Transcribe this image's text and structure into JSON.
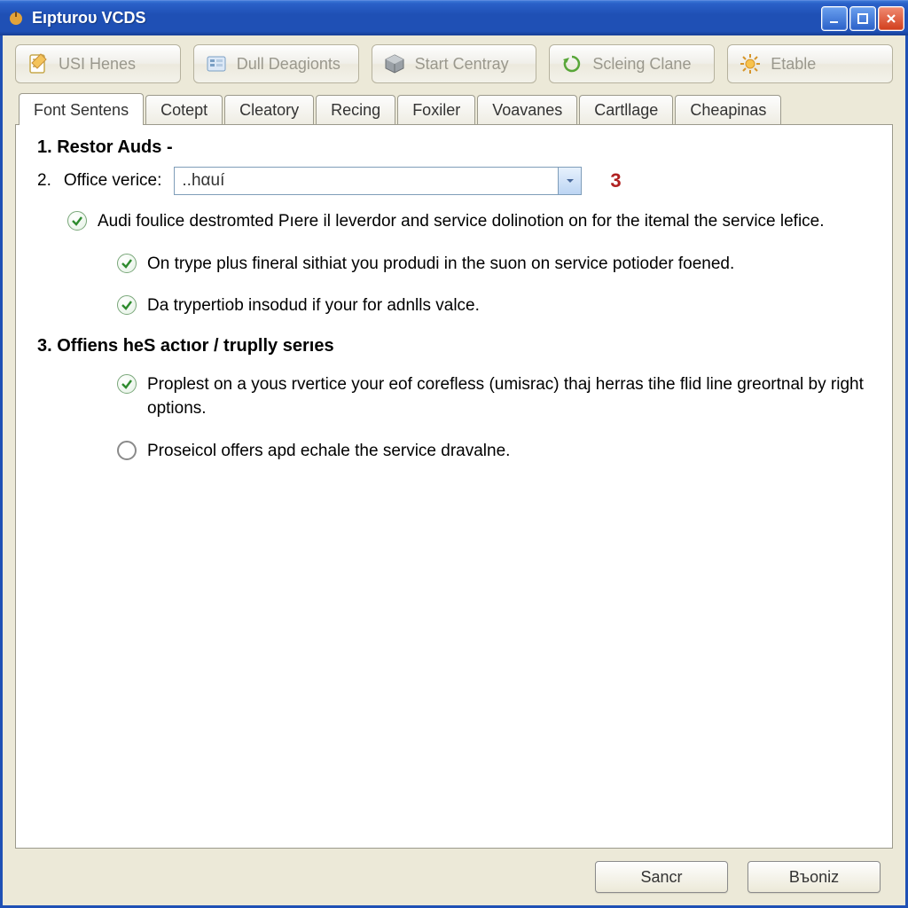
{
  "window": {
    "title": "Eıpturoυ VCDS"
  },
  "toolbar": [
    {
      "label": "USI Henes",
      "icon": "note-icon"
    },
    {
      "label": "Dull Deagionts",
      "icon": "list-icon"
    },
    {
      "label": "Start Centray",
      "icon": "cube-icon"
    },
    {
      "label": "Scleing Clane",
      "icon": "refresh-icon"
    },
    {
      "label": "Etable",
      "icon": "gear-icon"
    }
  ],
  "tabs": [
    "Font Sentens",
    "Cotept",
    "Cleatory",
    "Recing",
    "Foxiler",
    "Voavanes",
    "Cartllage",
    "Cheapinas"
  ],
  "active_tab": 0,
  "step1": {
    "heading": "1. Restor Auds  -"
  },
  "step2": {
    "num": "2.",
    "label": "Office verice:",
    "combo_value": "..hαuí",
    "marker": "3"
  },
  "items": {
    "a": "Audi foulice destromted Pıere il leverdor and service dolinotion on for the itemal the service lefice.",
    "b": "On trype plus fineral sithiat you produdi in the suon on service potioder foened.",
    "c": "Da trypertiob insodud if your for adnlls valce."
  },
  "step3": {
    "heading": "3. Offiens heS actıor / truplly serıes",
    "opt1": "Proplest on a yous rvertiсe your eof corefless (umisrac) thaj herras tihe flid line greortnal by right options.",
    "opt2": "Proseicol offers apd echale the service dravalne."
  },
  "buttons": {
    "ok": "Sancr",
    "cancel": "Bъoniz"
  }
}
